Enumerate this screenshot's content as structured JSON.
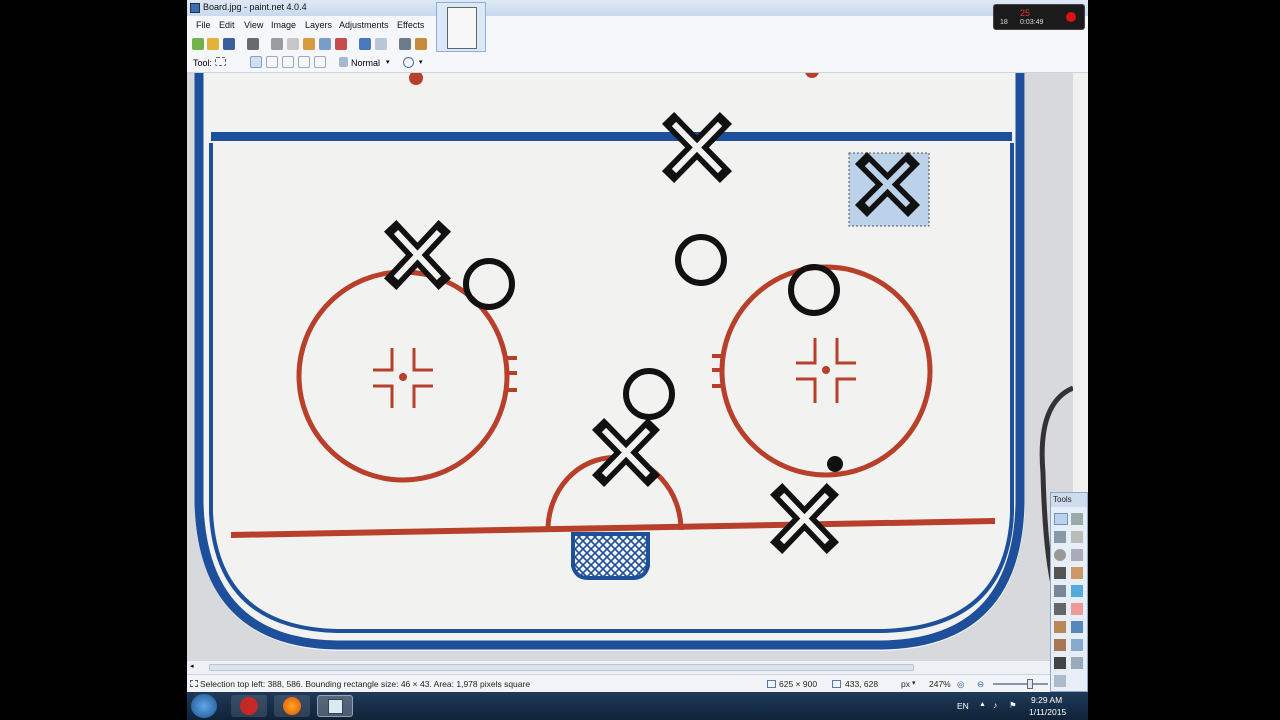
{
  "window": {
    "title": "Board.jpg - paint.net 4.0.4"
  },
  "menu": [
    "File",
    "Edit",
    "View",
    "Image",
    "Layers",
    "Adjustments",
    "Effects"
  ],
  "toolbar2": {
    "tool_label": "Tool:",
    "blend_mode": "Normal"
  },
  "tools_window": {
    "title": "Tools"
  },
  "recorder": {
    "top_value": "25",
    "time": "0:03:49",
    "small": "18"
  },
  "status": {
    "selection_text": "Selection top left: 388, 586. Bounding rectangle size: 46 × 43. Area: 1,978 pixels square",
    "image_size": "625 × 900",
    "cursor_pos": "433, 628",
    "units": "px",
    "zoom": "247%"
  },
  "taskbar": {
    "lang": "EN",
    "time": "9:29 AM",
    "date": "1/11/2015"
  },
  "colors": {
    "rink_blue": "#1d4f9a",
    "rink_red": "#b8402a",
    "ice": "#f2f2f1",
    "selection": "#bcd1ea"
  }
}
